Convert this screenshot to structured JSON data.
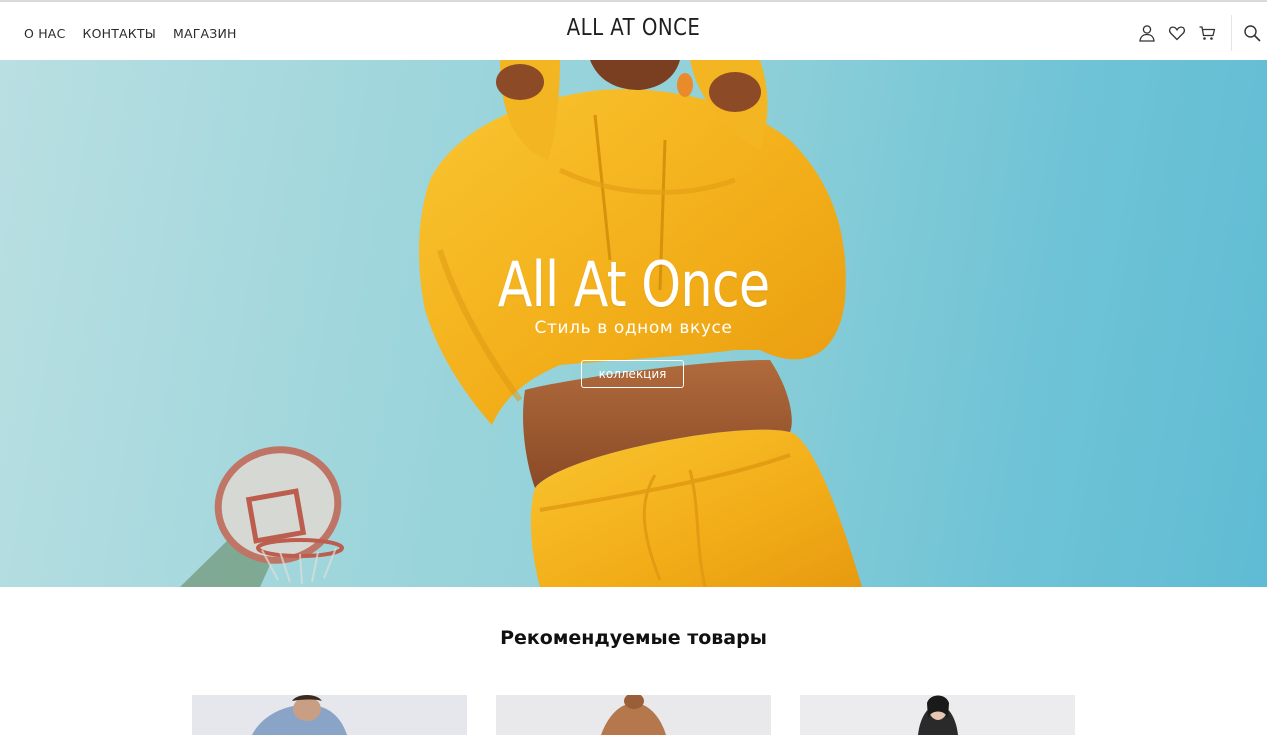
{
  "header": {
    "nav": [
      {
        "label": "О НАС"
      },
      {
        "label": "КОНТАКТЫ"
      },
      {
        "label": "МАГАЗИН"
      }
    ],
    "logo": "ALL AT ONCE",
    "icons": [
      "user-icon",
      "heart-icon",
      "cart-icon",
      "search-icon"
    ]
  },
  "hero": {
    "title": "All At Once",
    "subtitle": "Стиль в одном вкусе",
    "button_label": "коллекция"
  },
  "featured": {
    "title": "Рекомендуемые товары",
    "product_count": 3
  },
  "colors": {
    "sky": "#8fd0d8",
    "hoodie": "#f5b521",
    "text_dark": "#1f1f1f"
  }
}
